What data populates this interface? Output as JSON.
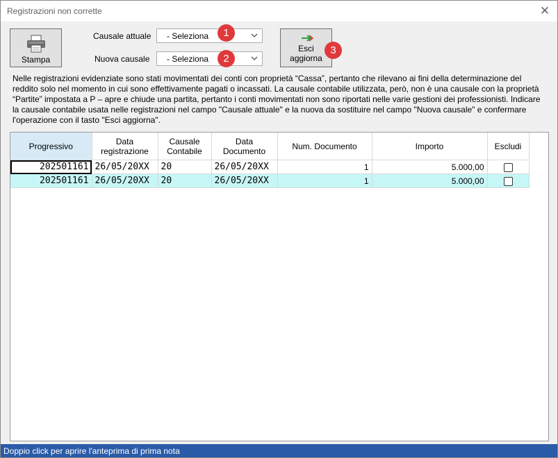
{
  "window": {
    "title": "Registrazioni non corrette",
    "close_icon": "close-icon"
  },
  "toolbar": {
    "stampa_label": "Stampa",
    "esci_label_1": "Esci",
    "esci_label_2": "aggiorna",
    "causale_attuale_label": "Causale attuale",
    "causale_attuale_value": "- Seleziona",
    "nuova_causale_label": "Nuova causale",
    "nuova_causale_value": "- Seleziona",
    "markers": [
      "1",
      "2",
      "3"
    ]
  },
  "description": "Nelle registrazioni evidenziate sono stati movimentati dei conti con proprietà “Cassa”, pertanto che rilevano ai fini della determinazione del reddito solo nel momento in cui sono effettivamente pagati o incassati. La causale contabile utilizzata, però, non è una causale con la proprietà “Partite” impostata a P – apre e chiude una partita, pertanto i conti movimentati non sono riportati nelle varie gestioni dei professionisti. Indicare la causale contabile usata nelle registrazioni nel campo \"Causale attuale\" e la nuova da sostituire nel campo \"Nuova causale\" e confermare l'operazione con il tasto \"Esci aggiorna\".",
  "table": {
    "headers": {
      "progressivo": "Progressivo",
      "data_reg_1": "Data",
      "data_reg_2": "registrazione",
      "causale_1": "Causale",
      "causale_2": "Contabile",
      "data_doc_1": "Data",
      "data_doc_2": "Documento",
      "num_doc": "Num. Documento",
      "importo": "Importo",
      "escludi": "Escludi"
    },
    "rows": [
      {
        "progressivo": "202501161",
        "data_registrazione": "26/05/20XX",
        "causale": "20",
        "data_documento": "26/05/20XX",
        "num_documento": "1",
        "importo": "5.000,00",
        "escludi": false
      },
      {
        "progressivo": "202501161",
        "data_registrazione": "26/05/20XX",
        "causale": "20",
        "data_documento": "26/05/20XX",
        "num_documento": "1",
        "importo": "5.000,00",
        "escludi": false
      }
    ]
  },
  "status": "Doppio click per aprire l'anteprima di prima nota",
  "colors": {
    "status_bar": "#2a5ca8",
    "highlight_row": "#c7f6f7",
    "marker": "#e0393b",
    "header_selected": "#d7eaf6"
  }
}
